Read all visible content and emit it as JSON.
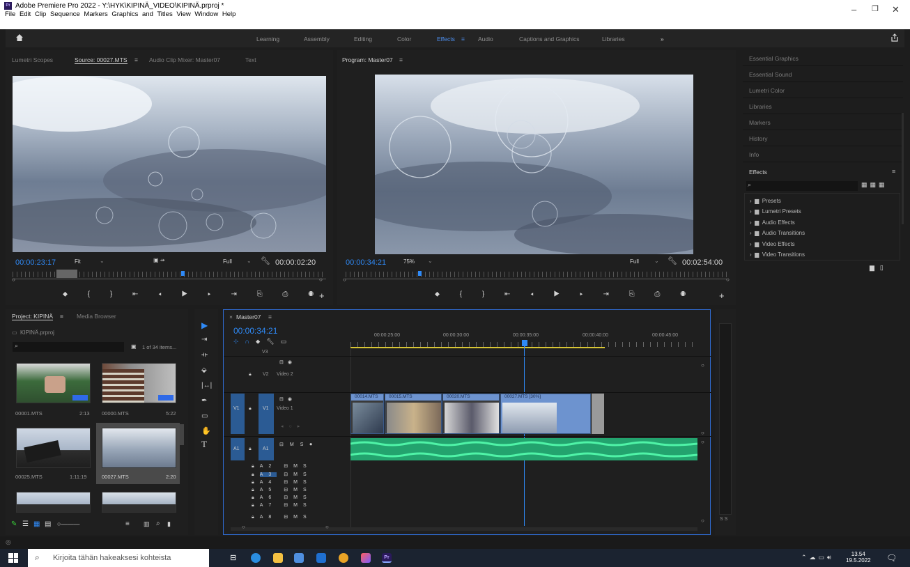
{
  "window": {
    "title": "Adobe Premiere Pro 2022 - Y:\\HYK\\KIPINÄ_VIDEO\\KIPINÄ.prproj *"
  },
  "menu": [
    "File",
    "Edit",
    "Clip",
    "Sequence",
    "Markers",
    "Graphics and Titles",
    "View",
    "Window",
    "Help"
  ],
  "workspaces": {
    "learning": "Learning",
    "assembly": "Assembly",
    "editing": "Editing",
    "color": "Color",
    "effects": "Effects",
    "audio": "Audio",
    "captions": "Captions and Graphics",
    "libraries": "Libraries"
  },
  "source_panel": {
    "tabs": {
      "scopes": "Lumetri Scopes",
      "source": "Source: 00027.MTS",
      "mixer": "Audio Clip Mixer: Master07",
      "text": "Text"
    },
    "timecode": "00:00:23:17",
    "fit": "Fit",
    "quality": "Full",
    "duration": "00:00:02:20"
  },
  "program_panel": {
    "tab": "Program: Master07",
    "timecode": "00:00:34:21",
    "zoom": "75%",
    "quality": "Full",
    "duration": "00:02:54:00"
  },
  "right_panels": [
    "Essential Graphics",
    "Essential Sound",
    "Lumetri Color",
    "Libraries",
    "Markers",
    "History",
    "Info"
  ],
  "effects_panel": {
    "title": "Effects",
    "items": [
      "Presets",
      "Lumetri Presets",
      "Audio Effects",
      "Audio Transitions",
      "Video Effects",
      "Video Transitions"
    ]
  },
  "project_panel": {
    "tab": "Project: KIPINÄ",
    "media_tab": "Media Browser",
    "file": "KIPINÄ.prproj",
    "count": "1 of 34 items...",
    "items": [
      {
        "name": "00001.MTS",
        "dur": "2:13"
      },
      {
        "name": "00000.MTS",
        "dur": "5:22"
      },
      {
        "name": "00025.MTS",
        "dur": "1:11:19"
      },
      {
        "name": "00027.MTS",
        "dur": "2:20"
      }
    ]
  },
  "timeline": {
    "tab": "Master07",
    "timecode": "00:00:34:21",
    "ruler": [
      "00:00:25:00",
      "00:00:30:00",
      "00:00:35:00",
      "00:00:40:00",
      "00:00:45:00"
    ],
    "tracks": {
      "v3": "V3",
      "v2": "V2",
      "v2name": "Video 2",
      "v1": "V1",
      "v1name": "Video 1",
      "a1": "A1",
      "a_extra": [
        "A2",
        "A3",
        "A4",
        "A5",
        "A6",
        "A7",
        "A8"
      ]
    },
    "clips": [
      "00014.MTS",
      "00015.MTS",
      "00020.MTS",
      "00027.MTS [30%]"
    ]
  },
  "taskbar": {
    "search": "Kirjoita tähän hakeaksesi kohteista",
    "time": "13.54",
    "date": "19.5.2022",
    "pr": "Pr"
  }
}
